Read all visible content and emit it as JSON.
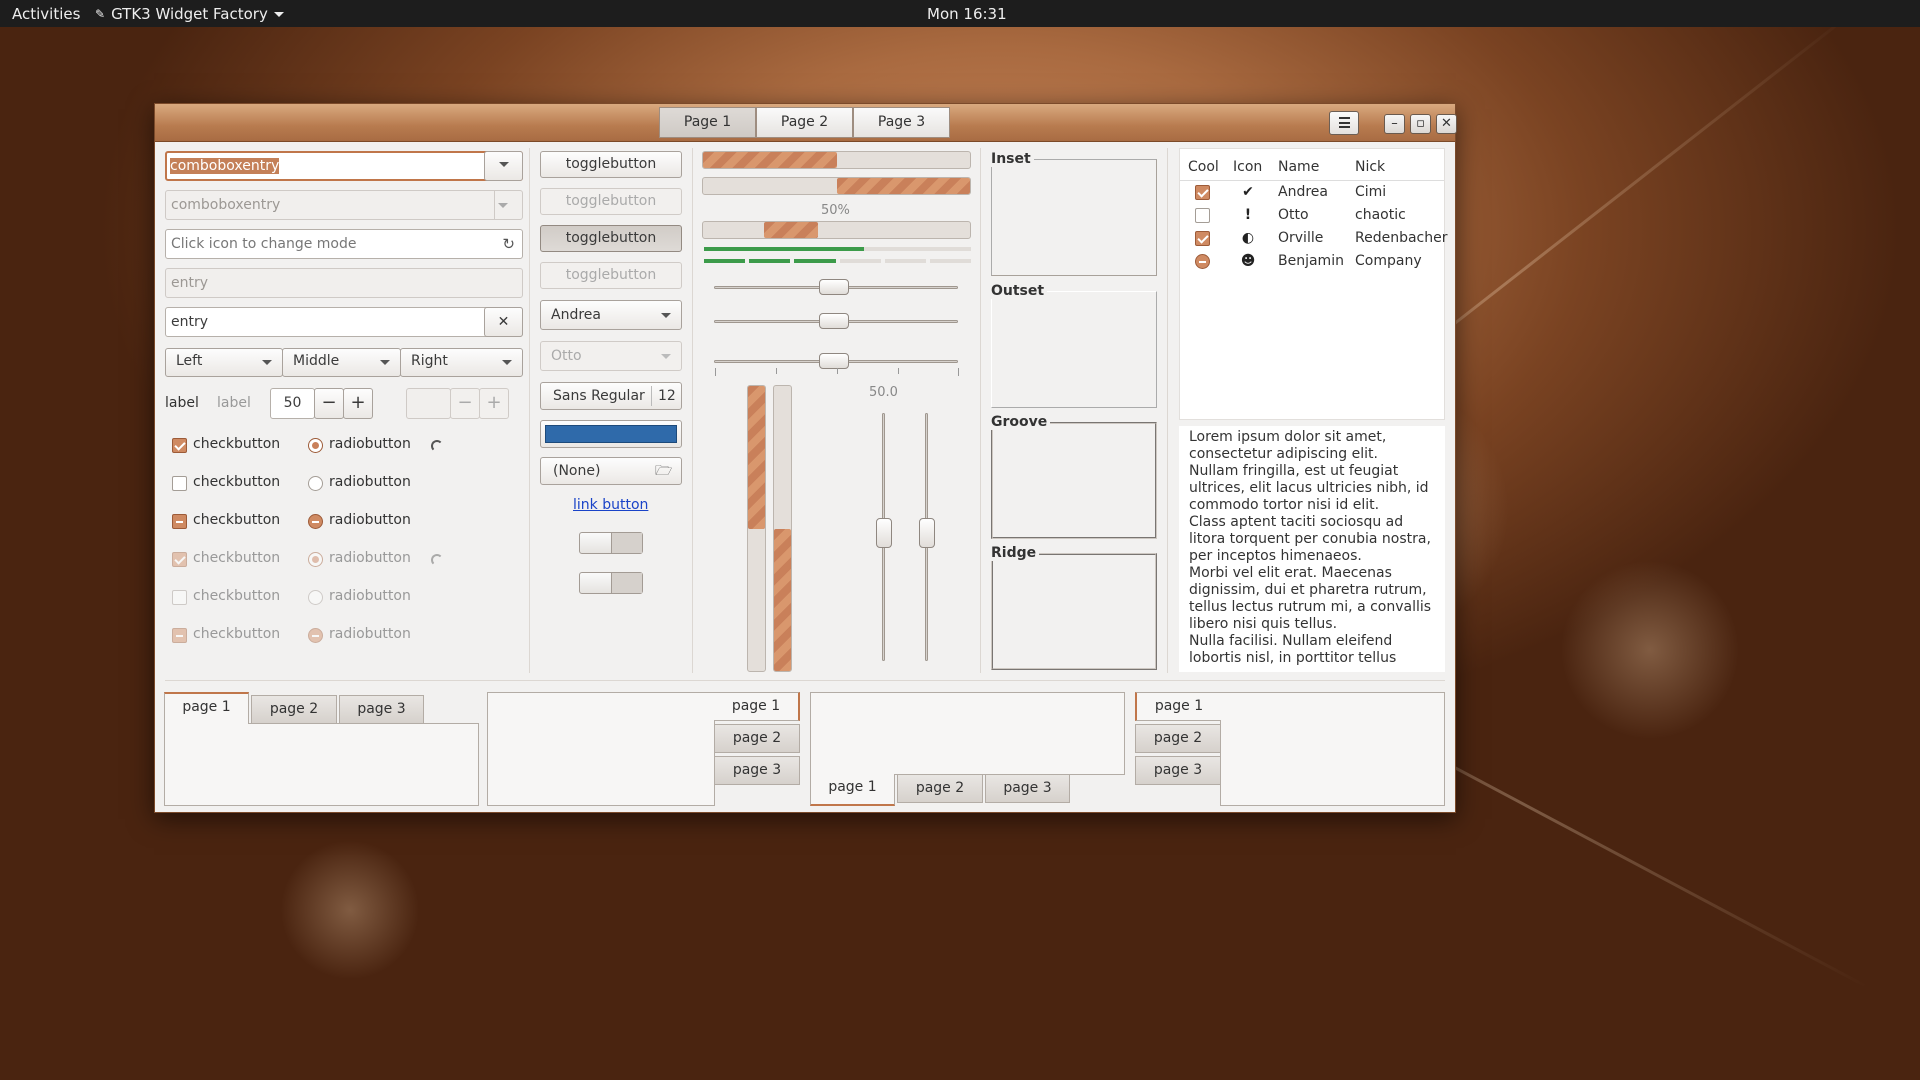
{
  "topbar": {
    "activities": "Activities",
    "app_name": "GTK3 Widget Factory",
    "clock": "Mon 16:31"
  },
  "header": {
    "tabs": [
      "Page 1",
      "Page 2",
      "Page 3"
    ]
  },
  "left": {
    "combo1": "comboboxentry",
    "combo2": "comboboxentry",
    "mode_placeholder": "Click icon to change mode",
    "entry_disabled": "entry",
    "entry": "entry",
    "align": [
      "Left",
      "Middle",
      "Right"
    ],
    "label1": "label",
    "label2": "label",
    "spin_value": "50",
    "checks": [
      "checkbutton",
      "checkbutton",
      "checkbutton",
      "checkbutton",
      "checkbutton",
      "checkbutton"
    ],
    "radios": [
      "radiobutton",
      "radiobutton",
      "radiobutton",
      "radiobutton",
      "radiobutton",
      "radiobutton"
    ]
  },
  "middle": {
    "toggles": [
      "togglebutton",
      "togglebutton",
      "togglebutton",
      "togglebutton"
    ],
    "combo_andrea": "Andrea",
    "combo_otto": "Otto",
    "font_name": "Sans Regular",
    "font_size": "12",
    "color": "#2f6aaa",
    "file": "(None)",
    "link": "link button"
  },
  "progress": {
    "bar1_fraction": 0.5,
    "bar2_fraction": 0.5,
    "label": "50%",
    "level_fraction": 0.6,
    "scale_value": "50.0",
    "vbar1_fraction": 0.5,
    "vbar2_fraction": 0.5,
    "accent": "#c9805a"
  },
  "frames": {
    "titles": [
      "Inset",
      "Outset",
      "Groove",
      "Ridge"
    ]
  },
  "tree": {
    "columns": [
      "Cool",
      "Icon",
      "Name",
      "Nick"
    ],
    "rows": [
      {
        "cool": "checked",
        "icon": "check-circle-icon",
        "glyph": "✔",
        "name": "Andrea",
        "nick": "Cimi"
      },
      {
        "cool": "unchecked",
        "icon": "warning-icon",
        "glyph": "!",
        "name": "Otto",
        "nick": "chaotic"
      },
      {
        "cool": "checked",
        "icon": "moon-icon",
        "glyph": "◐",
        "name": "Orville",
        "nick": "Redenbacher"
      },
      {
        "cool": "radio",
        "icon": "user-icon",
        "glyph": "☻",
        "name": "Benjamin",
        "nick": "Company"
      }
    ]
  },
  "textview": {
    "lines": [
      "Lorem ipsum dolor sit amet,",
      "consectetur adipiscing elit.",
      "Nullam fringilla, est ut feugiat",
      "ultrices, elit lacus ultricies nibh, id",
      "commodo tortor nisi id elit.",
      "Class aptent taciti sociosqu ad",
      "litora torquent per conubia nostra,",
      "per inceptos himenaeos.",
      "Morbi vel elit erat. Maecenas",
      "dignissim, dui et pharetra rutrum,",
      "tellus lectus rutrum mi, a convallis",
      "libero nisi quis tellus.",
      "Nulla facilisi. Nullam eleifend",
      "lobortis nisl, in porttitor tellus"
    ]
  },
  "notebooks": {
    "tabs": [
      "page 1",
      "page 2",
      "page 3"
    ]
  }
}
